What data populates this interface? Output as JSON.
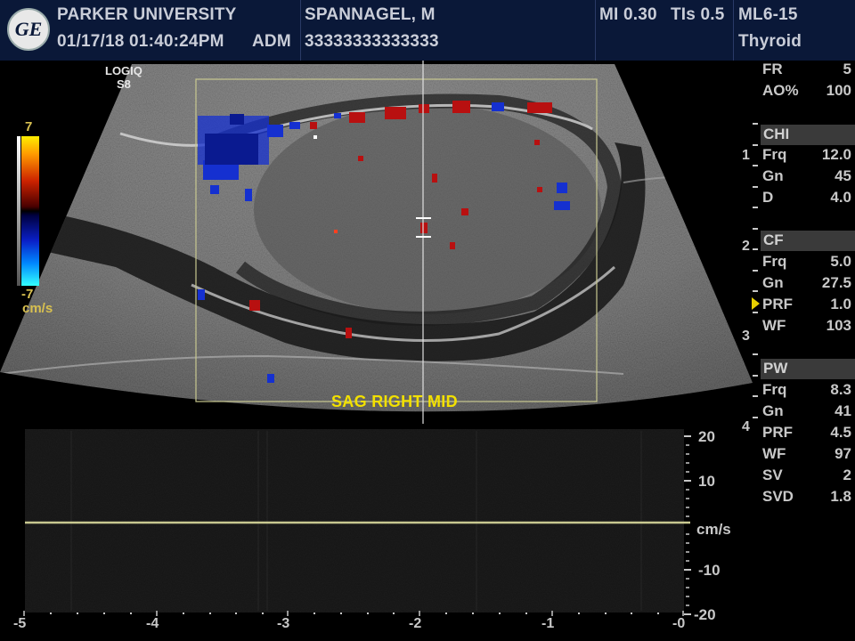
{
  "header": {
    "institution": "PARKER UNIVERSITY",
    "datetime": "01/17/18 01:40:24PM",
    "operator": "ADM",
    "patient_name": "SPANNAGEL, M",
    "patient_id": "33333333333333",
    "mi": "MI 0.30",
    "tis": "TIs 0.5",
    "probe": "ML6-15",
    "preset": "Thyroid",
    "logo_text": "GE"
  },
  "system": {
    "model": "LOGIQ",
    "model_sub": "S8"
  },
  "color_scale": {
    "max_label": "7",
    "min_label": "-7",
    "unit": "cm/s"
  },
  "params": {
    "top": [
      {
        "k": "FR",
        "v": "5"
      },
      {
        "k": "AO%",
        "v": "100"
      }
    ],
    "chi": {
      "title": "CHI",
      "rows": [
        {
          "k": "Frq",
          "v": "12.0"
        },
        {
          "k": "Gn",
          "v": "45"
        },
        {
          "k": "D",
          "v": "4.0"
        }
      ]
    },
    "cf": {
      "title": "CF",
      "rows": [
        {
          "k": "Frq",
          "v": "5.0"
        },
        {
          "k": "Gn",
          "v": "27.5"
        },
        {
          "k": "PRF",
          "v": "1.0"
        },
        {
          "k": "WF",
          "v": "103"
        }
      ]
    },
    "pw": {
      "title": "PW",
      "rows": [
        {
          "k": "Frq",
          "v": "8.3"
        },
        {
          "k": "Gn",
          "v": "41"
        },
        {
          "k": "PRF",
          "v": "4.5"
        },
        {
          "k": "WF",
          "v": "97"
        },
        {
          "k": "SV",
          "v": "2"
        },
        {
          "k": "SVD",
          "v": "1.8"
        }
      ]
    }
  },
  "depth_scale": [
    "1",
    "2",
    "3",
    "4"
  ],
  "annotation": "SAG RIGHT MID",
  "spectral": {
    "x_labels": [
      "-5",
      "-4",
      "-3",
      "-2",
      "-1",
      "-0"
    ],
    "y_labels": [
      "20",
      "10",
      "-10",
      "-20"
    ],
    "unit": "cm/s"
  },
  "colors": {
    "header_bg": "#0a1838",
    "annotation": "#f2e000",
    "roi_box": "#c8c890",
    "baseline": "#c8c890"
  }
}
